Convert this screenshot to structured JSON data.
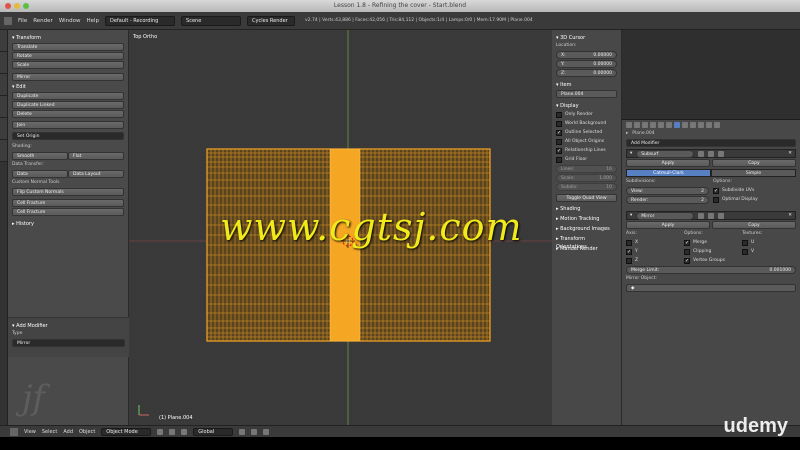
{
  "window": {
    "title": "Lesson 1.8 - Refining the cover - Start.blend"
  },
  "menubar": {
    "items": [
      "File",
      "Render",
      "Window",
      "Help"
    ],
    "layout": "Default - Recording",
    "scene": "Scene",
    "engine": "Cycles Render",
    "stats": "v2.74 | Verts:43,886 | Faces:42,056 | Tris:84,112 | Objects:1/4 | Lamps:0/0 | Mem:17.90M | Plane.004"
  },
  "toolshelf": {
    "transform_header": "Transform",
    "translate": "Translate",
    "rotate": "Rotate",
    "scale": "Scale",
    "mirror": "Mirror",
    "edit_header": "Edit",
    "duplicate": "Duplicate",
    "duplicate_linked": "Duplicate Linked",
    "delete": "Delete",
    "join": "Join",
    "set_origin": "Set Origin",
    "shading_label": "Shading:",
    "smooth": "Smooth",
    "flat": "Flat",
    "data_transfer_label": "Data Transfer:",
    "data": "Data",
    "data_layout": "Data Layout",
    "custom_normal_label": "Custom Normal Tools",
    "flip_custom_normals": "Flip Custom Normals",
    "cell_fracture_1": "Cell Fracture",
    "cell_fracture_2": "Cell Fracture",
    "history_header": "History",
    "add_modifier_header": "Add Modifier",
    "type_label": "Type",
    "type_value": "Mirror"
  },
  "viewport": {
    "view_label": "Top Ortho",
    "object_label": "(1) Plane.004"
  },
  "props_panel": {
    "cursor_header": "3D Cursor",
    "location_label": "Location:",
    "x_label": "X:",
    "x_value": "0.00000",
    "y_label": "Y:",
    "y_value": "0.00000",
    "z_label": "Z:",
    "z_value": "0.00000",
    "item_header": "Item",
    "item_name": "Plane.004",
    "display_header": "Display",
    "only_render": "Only Render",
    "world_background": "World Background",
    "outline_selected": "Outline Selected",
    "all_object_origins": "All Object Origins",
    "relationship_lines": "Relationship Lines",
    "grid_floor": "Grid Floor",
    "lines": "Lines:",
    "lines_val": "16",
    "scale": "Scale:",
    "scale_val": "1.000",
    "subdiv": "Subdiv:",
    "subdiv_val": "10",
    "toggle_quad_view": "Toggle Quad View",
    "shading_header": "Shading",
    "motion_tracking": "Motion Tracking",
    "background_images": "Background Images",
    "transform_orientations": "Transform Orientations",
    "manuel_render": "Manuel Render"
  },
  "modifier_panel": {
    "object_name": "Plane.004",
    "add_modifier": "Add Modifier",
    "subsurf_name": "Subsurf",
    "apply": "Apply",
    "copy": "Copy",
    "catmull_clark": "Catmull-Clark",
    "simple": "Simple",
    "subdivisions_label": "Subdivisions:",
    "view_label": "View:",
    "view_val": "2",
    "render_label": "Render:",
    "render_val": "2",
    "options_label": "Options:",
    "subdivide_uvs": "Subdivide UVs",
    "optimal_display": "Optimal Display",
    "mirror_name": "Mirror",
    "apply2": "Apply",
    "copy2": "Copy",
    "axis_label": "Axis:",
    "options2_label": "Options:",
    "textures_label": "Textures:",
    "axis_x": "X",
    "axis_y": "Y",
    "axis_z": "Z",
    "merge": "Merge",
    "clipping": "Clipping",
    "vertex_groups": "Vertex Groups",
    "tex_u": "U",
    "tex_v": "V",
    "merge_limit_label": "Merge Limit:",
    "merge_limit_value": "0.001000",
    "mirror_object_label": "Mirror Object:"
  },
  "footer": {
    "view": "View",
    "select": "Select",
    "add": "Add",
    "object": "Object",
    "mode": "Object Mode",
    "orientation": "Global"
  },
  "overlay": {
    "watermark": "www.cgtsj.com",
    "brand": "udemy"
  },
  "colors": {
    "accent": "#5680c2",
    "selection": "#f5a623",
    "watermark": "#f1ea1b"
  }
}
